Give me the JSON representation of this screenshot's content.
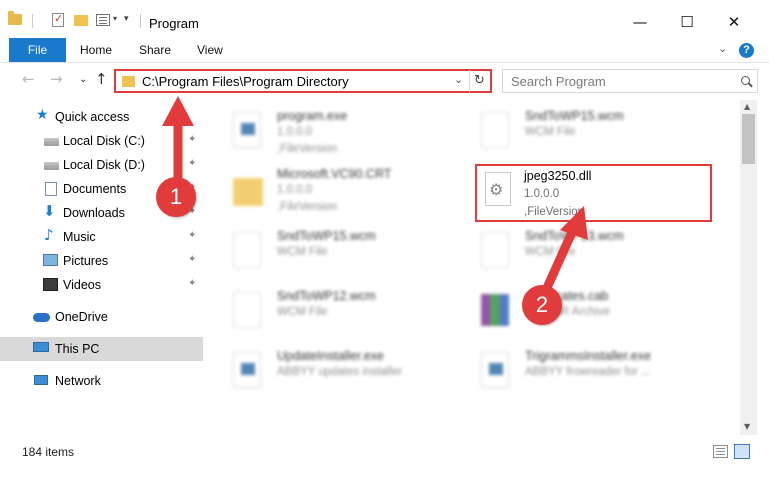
{
  "window": {
    "title": "Program",
    "minimize_glyph": "—",
    "maximize_glyph": "☐",
    "close_glyph": "✕"
  },
  "ribbon": {
    "tabs": [
      "File",
      "Home",
      "Share",
      "View"
    ],
    "help_glyph": "?",
    "expand_glyph": "⌄"
  },
  "nav": {
    "back_glyph": "←",
    "forward_glyph": "→",
    "recent_glyph": "⌄",
    "up_glyph": "↑",
    "address": "C:\\Program Files\\Program Directory",
    "address_dropdown_glyph": "⌄",
    "refresh_glyph": "↻",
    "search_placeholder": "Search Program"
  },
  "sidebar": {
    "items": [
      {
        "label": "Quick access",
        "icon": "star-icon"
      },
      {
        "label": "Local Disk (C:)",
        "icon": "disk-icon",
        "pinned": true
      },
      {
        "label": "Local Disk (D:)",
        "icon": "disk-icon",
        "pinned": true
      },
      {
        "label": "Documents",
        "icon": "documents-icon",
        "pinned": true
      },
      {
        "label": "Downloads",
        "icon": "download-icon",
        "pinned": true
      },
      {
        "label": "Music",
        "icon": "music-icon",
        "pinned": true
      },
      {
        "label": "Pictures",
        "icon": "pictures-icon",
        "pinned": true
      },
      {
        "label": "Videos",
        "icon": "videos-icon",
        "pinned": true
      },
      {
        "label": "OneDrive",
        "icon": "cloud-icon"
      },
      {
        "label": "This PC",
        "icon": "pc-icon",
        "selected": true
      },
      {
        "label": "Network",
        "icon": "network-icon"
      }
    ],
    "pin_glyph": "📌"
  },
  "files": [
    {
      "name": "program.exe",
      "line2": "1.0.0.0",
      "line3": ",FileVersion",
      "icon": "exe-icon",
      "blurred": true
    },
    {
      "name": "SndToWP15.wcm",
      "line2": "WCM File",
      "line3": "",
      "icon": "file-icon",
      "blurred": true
    },
    {
      "name": "Microsoft.VC90.CRT",
      "line2": "1.0.0.0",
      "line3": ",FileVersion",
      "icon": "folder-icon",
      "blurred": true
    },
    {
      "name": "jpeg3250.dll",
      "line2": "1.0.0.0",
      "line3": ",FileVersion",
      "icon": "dll-gear-icon",
      "blurred": false,
      "highlighted": true
    },
    {
      "name": "SndToWP15.wcm",
      "line2": "WCM File",
      "line3": "",
      "icon": "file-icon",
      "blurred": true
    },
    {
      "name": "SndToWP13.wcm",
      "line2": "WCM File",
      "line3": "",
      "icon": "file-icon",
      "blurred": true
    },
    {
      "name": "SndToWP12.wcm",
      "line2": "WCM File",
      "line3": "",
      "icon": "file-icon",
      "blurred": true
    },
    {
      "name": "certificates.cab",
      "line2": "WinRAR Archive",
      "line3": "",
      "icon": "rar-icon",
      "blurred": true
    },
    {
      "name": "UpdateInstaller.exe",
      "line2": "ABBYY updates installer",
      "line3": "",
      "icon": "exe-icon",
      "blurred": true
    },
    {
      "name": "TrigrammsInstaller.exe",
      "line2": "ABBYY frowreader for ...",
      "line3": "",
      "icon": "exe-icon",
      "blurred": true
    }
  ],
  "status": {
    "item_count": "184 items"
  },
  "annotations": {
    "step1": "1",
    "step2": "2",
    "color": "#e23b3b"
  },
  "colors": {
    "accent": "#1979ca",
    "highlight": "#e23b3b",
    "folder": "#f0c34e"
  }
}
